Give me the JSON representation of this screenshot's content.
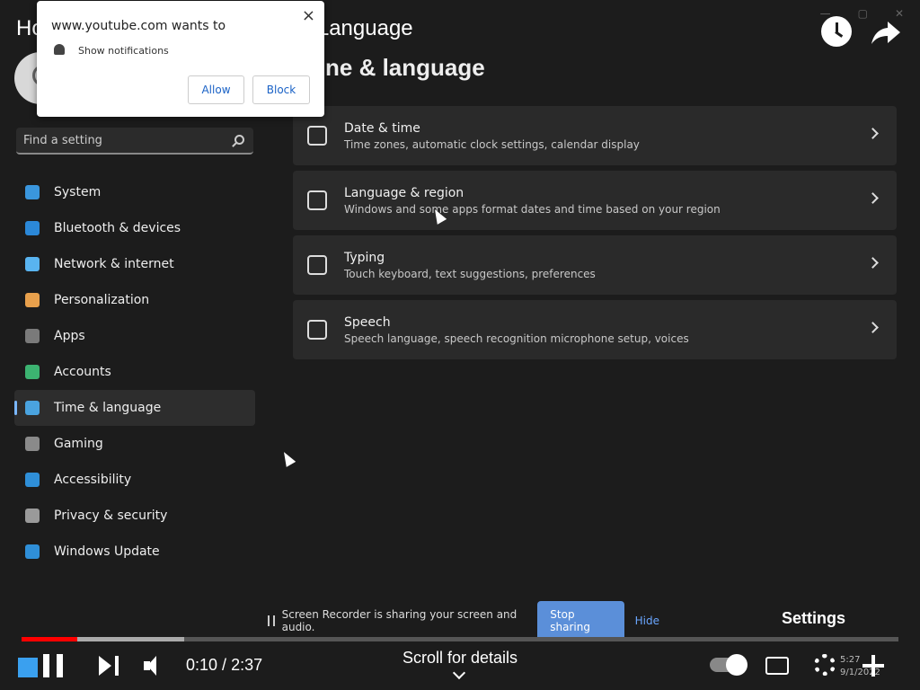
{
  "video": {
    "title": "How to Change Feedback Hub Language",
    "current_time": "0:10",
    "duration": "2:37",
    "time_separator": " / ",
    "settings_tooltip": "Settings",
    "scroll_label": "Scroll for details",
    "progress_played_percent": 6.4,
    "progress_buffered_percent": 18.5
  },
  "settings": {
    "page_title": "ne & language",
    "search_placeholder": "Find a setting",
    "nav": [
      {
        "label": "System",
        "color": "#3a96dd"
      },
      {
        "label": "Bluetooth & devices",
        "color": "#2b88d8"
      },
      {
        "label": "Network & internet",
        "color": "#59b4f0"
      },
      {
        "label": "Personalization",
        "color": "#e8a04c"
      },
      {
        "label": "Apps",
        "color": "#7a7a7a"
      },
      {
        "label": "Accounts",
        "color": "#3cb371"
      },
      {
        "label": "Time & language",
        "color": "#4aa3df"
      },
      {
        "label": "Gaming",
        "color": "#8a8a8a"
      },
      {
        "label": "Accessibility",
        "color": "#2f8fd8"
      },
      {
        "label": "Privacy & security",
        "color": "#9a9a9a"
      },
      {
        "label": "Windows Update",
        "color": "#2f8fd8"
      }
    ],
    "cards": [
      {
        "title": "Date & time",
        "desc": "Time zones, automatic clock settings, calendar display"
      },
      {
        "title": "Language & region",
        "desc": "Windows and some apps format dates and time based on your region"
      },
      {
        "title": "Typing",
        "desc": "Touch keyboard, text suggestions, preferences"
      },
      {
        "title": "Speech",
        "desc": "Speech language, speech recognition microphone setup, voices"
      }
    ]
  },
  "share_bar": {
    "message": "Screen Recorder is sharing your screen and audio.",
    "stop_label": "Stop sharing",
    "hide_label": "Hide"
  },
  "popup": {
    "title": "www.youtube.com wants to",
    "message": "Show notifications",
    "allow_label": "Allow",
    "block_label": "Block",
    "close_glyph": "×"
  },
  "tray": {
    "time": "5:27",
    "date": "9/1/2022"
  }
}
